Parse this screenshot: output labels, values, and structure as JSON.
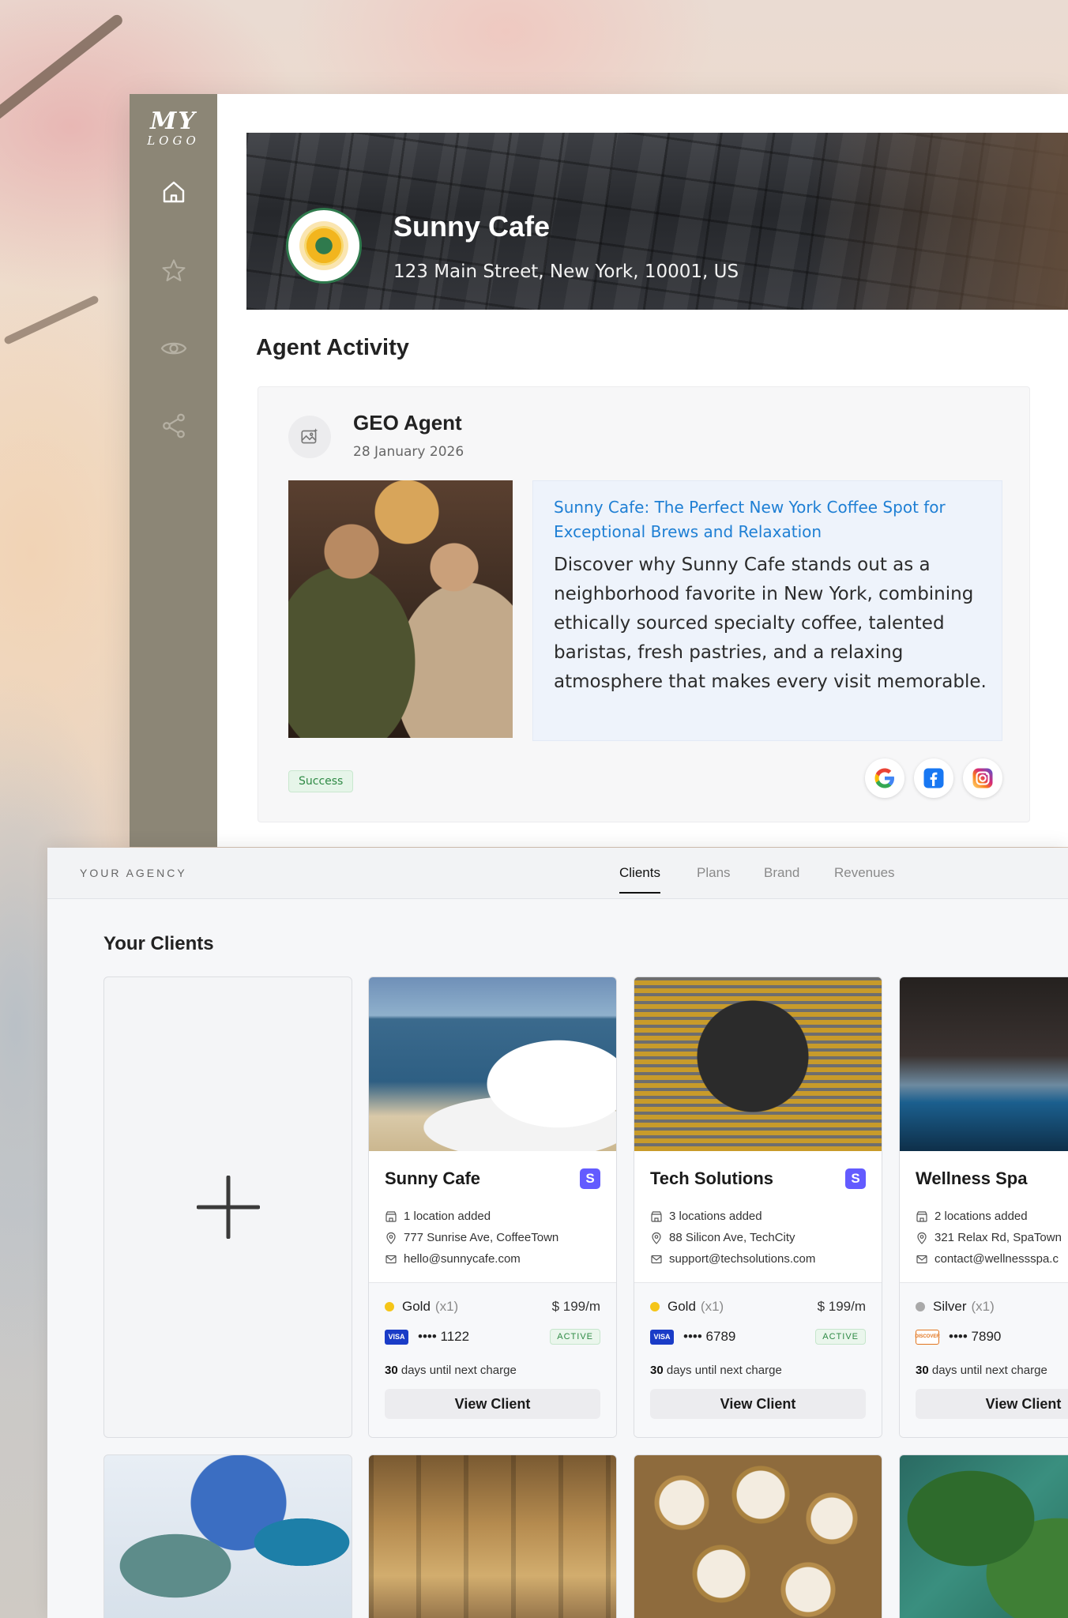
{
  "app": {
    "logo": {
      "line1": "MY",
      "line2": "LOGO"
    },
    "sidebar": {
      "icons": [
        "home-icon",
        "star-icon",
        "eye-icon",
        "share-icon"
      ]
    },
    "business": {
      "name": "Sunny Cafe",
      "address": "123 Main Street, New York, 10001, US"
    },
    "activity": {
      "section_title": "Agent Activity",
      "agent_name": "GEO Agent",
      "date": "28 January 2026",
      "post_title": "Sunny Cafe: The Perfect New York Coffee Spot for Exceptional Brews and Relaxation",
      "post_body": "Discover why Sunny Cafe stands out as a neighborhood favorite in New York, combining ethically sourced specialty coffee, talented baristas, fresh pastries, and a relaxing atmosphere that makes every visit memorable.",
      "status": "Success",
      "channels": [
        "google-icon",
        "facebook-icon",
        "instagram-icon"
      ]
    }
  },
  "agency": {
    "label": "YOUR AGENCY",
    "tabs": [
      {
        "label": "Clients",
        "active": true
      },
      {
        "label": "Plans",
        "active": false
      },
      {
        "label": "Brand",
        "active": false
      },
      {
        "label": "Revenues",
        "active": false
      }
    ],
    "clients_title": "Your Clients",
    "clients": [
      {
        "name": "Sunny Cafe",
        "badge": "S",
        "locations": "1 location added",
        "address": "777 Sunrise Ave, CoffeeTown",
        "email": "hello@sunnycafe.com",
        "plan": "Gold",
        "plan_qty": "(x1)",
        "plan_color": "#f5c518",
        "price": "$ 199/m",
        "card_brand": "VISA",
        "card_last4": "•••• 1122",
        "status": "ACTIVE",
        "days": "30",
        "days_text": "days until next charge",
        "button": "View Client"
      },
      {
        "name": "Tech Solutions",
        "badge": "S",
        "locations": "3 locations added",
        "address": "88 Silicon Ave, TechCity",
        "email": "support@techsolutions.com",
        "plan": "Gold",
        "plan_qty": "(x1)",
        "plan_color": "#f5c518",
        "price": "$ 199/m",
        "card_brand": "VISA",
        "card_last4": "•••• 6789",
        "status": "ACTIVE",
        "days": "30",
        "days_text": "days until next charge",
        "button": "View Client"
      },
      {
        "name": "Wellness Spa",
        "locations": "2 locations added",
        "address": "321 Relax Rd, SpaTown",
        "email": "contact@wellnessspa.c",
        "plan": "Silver",
        "plan_qty": "(x1)",
        "plan_color": "#a9a9a9",
        "card_brand": "DISCOVER",
        "card_last4": "•••• 7890",
        "days": "30",
        "days_text": "days until next charge",
        "button": "View Client"
      }
    ]
  }
}
